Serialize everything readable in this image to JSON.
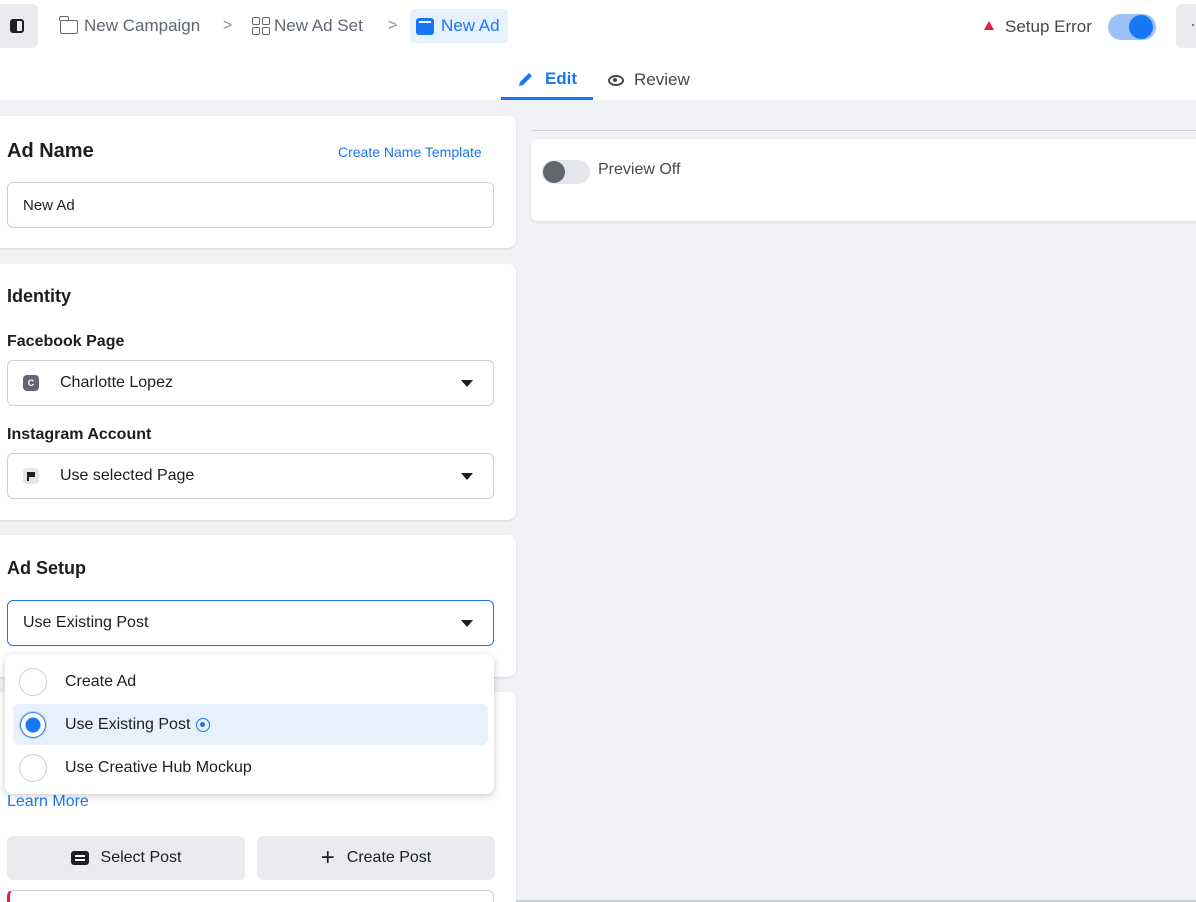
{
  "breadcrumb": {
    "campaign": "New Campaign",
    "adset": "New Ad Set",
    "ad": "New Ad",
    "separator": ">"
  },
  "status": {
    "setup_error": "Setup Error",
    "toggle_on": true
  },
  "more_label": "·",
  "tabs": {
    "edit": "Edit",
    "review": "Review"
  },
  "ad_name": {
    "title": "Ad Name",
    "template_link": "Create Name Template",
    "value": "New Ad"
  },
  "identity": {
    "title": "Identity",
    "facebook_page_label": "Facebook Page",
    "facebook_page_value": "Charlotte Lopez",
    "facebook_page_avatar": "C",
    "instagram_label": "Instagram Account",
    "instagram_value": "Use selected Page"
  },
  "ad_setup": {
    "title": "Ad Setup",
    "selected": "Use Existing Post",
    "options": [
      {
        "label": "Create Ad",
        "selected": false
      },
      {
        "label": "Use Existing Post",
        "selected": true
      },
      {
        "label": "Use Creative Hub Mockup",
        "selected": false
      }
    ]
  },
  "learn_more": "Learn More",
  "buttons": {
    "select_post": "Select Post",
    "create_post": "Create Post",
    "create_post_symbol": "+"
  },
  "preview": {
    "label": "Preview Off",
    "on": false
  },
  "colors": {
    "accent": "#1877f2",
    "error": "#e41e3f",
    "background": "#f0f2f5"
  }
}
